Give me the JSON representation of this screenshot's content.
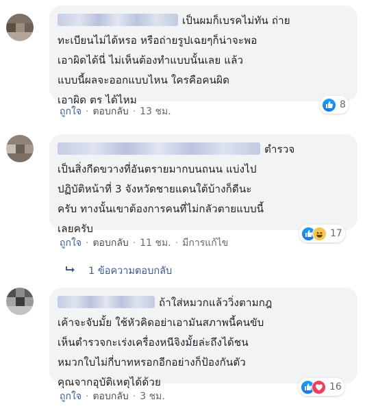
{
  "comments": [
    {
      "text": [
        "เป็นผมก็เบรคไม่ทัน ถ่าย",
        "ทะเบียนไม่ได้หรอ หรือถ่ายรูปเฉยๆก็น่าจะพอ",
        "เอาผิดได้นี่ ไม่เห็นต้องทำแบบนั้นเลย แล้ว",
        "แบบนี้ผลจะออกแบบไหน ใครคือคนผิด",
        "เอาผิด ตร ได้ไหม"
      ],
      "reaction_count": "8",
      "reaction_icons": [
        "like-icon"
      ],
      "actions": {
        "like": "ถูกใจ",
        "reply": "ตอบกลับ",
        "time": "13 ชม."
      }
    },
    {
      "text": [
        "ตำรวจ",
        "เป็นสิ่งกีดขวางที่อันตรายมากบนถนน แบ่งไป",
        "ปฏิบัติหน้าที่ 3 จังหวัดชายแดนใต้บ้างก็ดีนะ",
        "ครับ ทางนั้นเขาต้องการคนที่ไม่กลัวตายแบบนี้",
        "เลยครับ"
      ],
      "reaction_count": "17",
      "reaction_icons": [
        "like-icon",
        "haha-icon"
      ],
      "actions": {
        "like": "ถูกใจ",
        "reply": "ตอบกลับ",
        "time": "11 ชม.",
        "edited": "มีการแก้ไข"
      }
    },
    {
      "text": [
        "ถ้าใส่หมวกแล้ววิ่งตามกฎ",
        "เค้าจะจับมั้ย ใช้หัวคิดอย่าเอามันสภาพนี้คนขับ",
        "เห็นตำรวจกะเร่งเครื่องหนีจิงมั้ยล่ะถึงได้ชน",
        "หมวกใบไม่กี่บาทหรอกอีกอย่างก็ป้องกันตัว",
        "คุณจากอุบัติเหตุได้ด้วย"
      ],
      "reaction_count": "16",
      "reaction_icons": [
        "like-icon",
        "love-icon"
      ],
      "actions": {
        "like": "ถูกใจ",
        "reply": "ตอบกลับ",
        "time": "3 ชม."
      }
    }
  ],
  "replies_link": "1 ข้อความตอบกลับ",
  "colors": {
    "bubble": "#f2f3f5",
    "link": "#385898",
    "meta": "#65676b",
    "like": "#1877f2"
  }
}
